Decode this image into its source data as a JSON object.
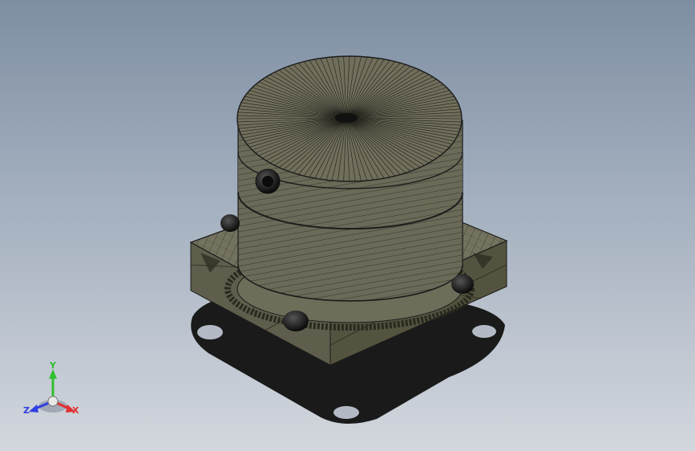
{
  "viewport": {
    "background_top": "#7e8ea2",
    "background_bottom": "#d3d7de"
  },
  "model": {
    "kind": "mesh-view",
    "mesh_color": "#6b6a58",
    "edge_color": "#1c1c1c",
    "shadow_color": "#1a1a1a",
    "bolt_count": 4
  },
  "triad": {
    "x_label": "X",
    "y_label": "Y",
    "z_label": "Z",
    "x_color": "#e03030",
    "y_color": "#2fbf2f",
    "z_color": "#2f3fe0"
  }
}
